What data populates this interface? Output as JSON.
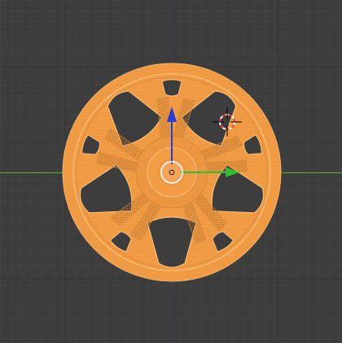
{
  "viewport": {
    "background": "#3d3d3d",
    "grid_minor_color": "#474747",
    "grid_major_color": "#363636",
    "x_axis_color": "#6fa83a",
    "z_axis_color": "#3434c8"
  },
  "object": {
    "selected": true,
    "wire_color": "#f5a850",
    "fill_color": "#f29c45",
    "dense_color": "#d98a3a"
  },
  "gizmo": {
    "z_arrow_color": "#2a3cd8",
    "x_arrow_color": "#2ec22e",
    "pivot_color": "#ffffff"
  },
  "cursor": {
    "ring_color_a": "#ffffff",
    "ring_color_b": "#ff3030",
    "crosshair_color": "#000000"
  },
  "icons": [
    "3d-cursor-icon",
    "transform-gizmo-icon",
    "object-origin-icon"
  ]
}
